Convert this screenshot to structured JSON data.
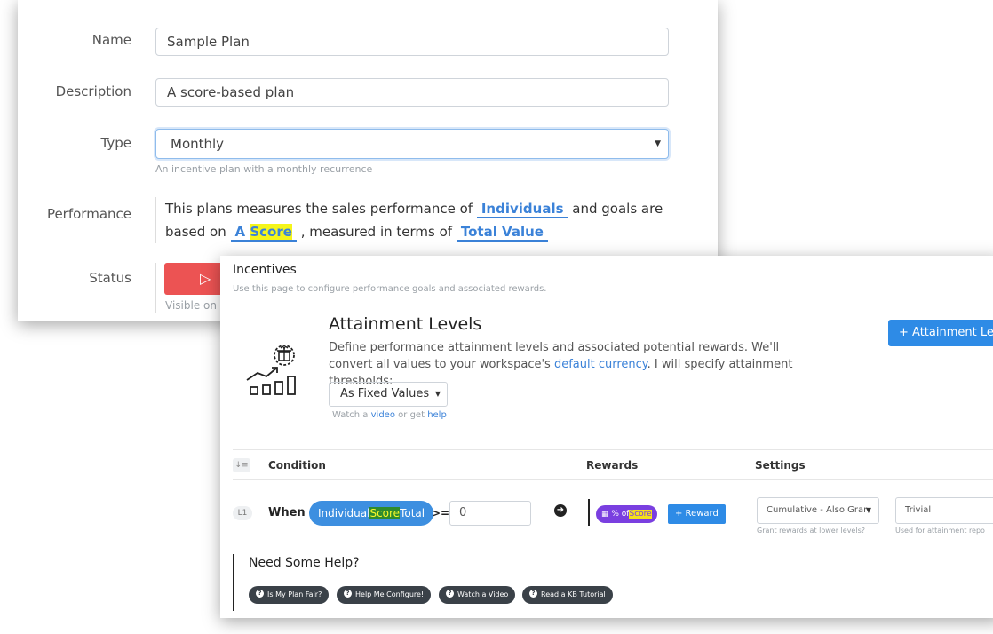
{
  "plan_form": {
    "name_label": "Name",
    "name_value": "Sample Plan",
    "description_label": "Description",
    "description_value": "A score-based plan",
    "type_label": "Type",
    "type_value": "Monthly",
    "type_help": "An incentive plan with a monthly recurrence",
    "performance_label": "Performance",
    "performance_text_1": "This plans measures the sales performance of",
    "performance_individuals": "Individuals",
    "performance_text_2": "and goals are based on",
    "performance_a": "A",
    "performance_score": "Score",
    "performance_text_3": ", measured in terms of",
    "performance_total_value": "Total Value",
    "status_label": "Status",
    "status_help": "Visible on p"
  },
  "incentives": {
    "title": "Incentives",
    "subtitle": "Use this page to configure performance goals and associated rewards.",
    "attainment_title": "Attainment Levels",
    "attainment_desc_1": "Define performance attainment levels and associated potential rewards. We'll convert all values to your workspace's",
    "attainment_desc_link": "default currency",
    "attainment_desc_2": ". I will specify attainment thresholds:",
    "threshold_mode": "As Fixed Values",
    "watch_text_1": "Watch a",
    "watch_video": "video",
    "watch_text_2": "or get",
    "watch_help": "help",
    "add_level_button": "+ Attainment Lev",
    "table_headers": {
      "condition": "Condition",
      "rewards": "Rewards",
      "settings": "Settings"
    },
    "level": {
      "badge": "L1",
      "when": "When",
      "metric_1": "Individual",
      "metric_score": "Score",
      "metric_2": "Total",
      "operator": ">=",
      "threshold": "0",
      "reward_prefix": "% of",
      "reward_score": "Score",
      "reward_button": "+ Reward",
      "cumulative_select": "Cumulative - Also Grar",
      "cumulative_help": "Grant rewards at lower levels?",
      "difficulty_select": "Trivial",
      "difficulty_help": "Used for attainment repo"
    },
    "help": {
      "title": "Need Some Help?",
      "buttons": [
        "Is My Plan Fair?",
        "Help Me Configure!",
        "Watch a Video",
        "Read a KB Tutorial"
      ]
    }
  },
  "colors": {
    "accent_blue": "#3b82d8",
    "status_red": "#ec5353",
    "reward_purple": "#7a3fe0",
    "highlight_yellow": "#f5f51a",
    "highlight_green": "#2e8b2e"
  }
}
